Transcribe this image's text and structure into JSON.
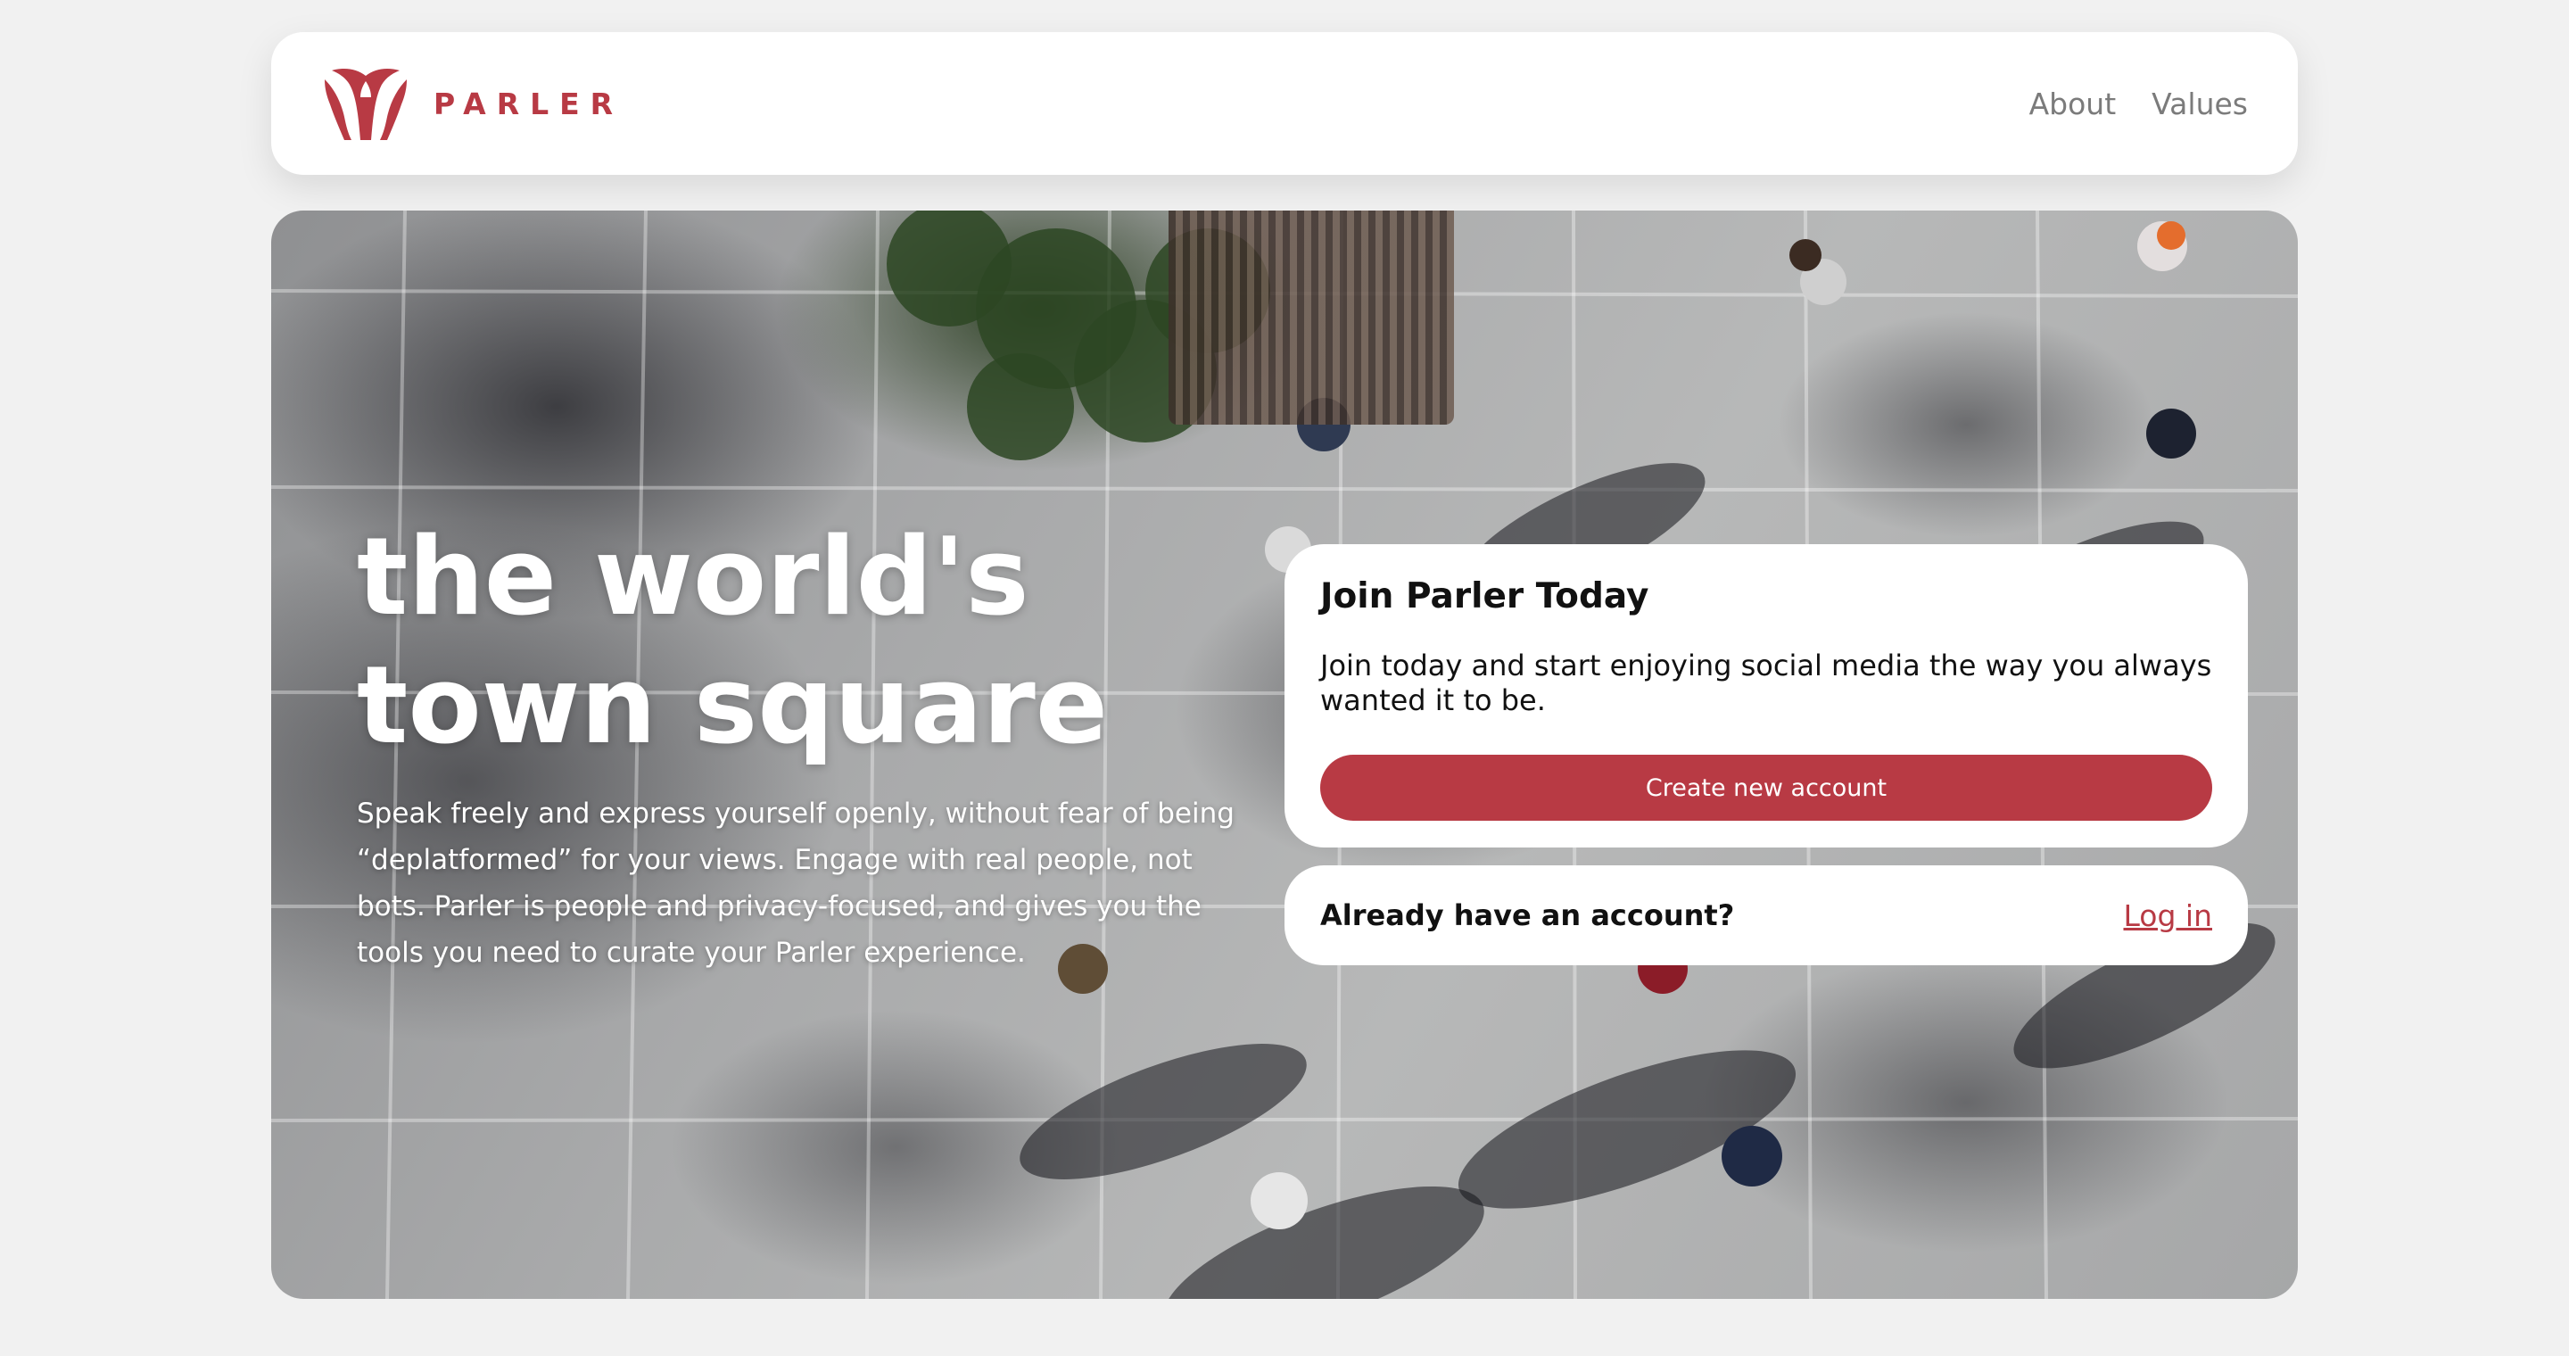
{
  "brand": {
    "name": "PARLER",
    "logo_icon": "parler-logo-icon",
    "color": "#b83a44"
  },
  "nav": {
    "items": [
      {
        "label": "About"
      },
      {
        "label": "Values"
      }
    ]
  },
  "hero": {
    "headline_line1": "the world's",
    "headline_line2": "town square",
    "body": "Speak freely and express yourself openly, without fear of being “deplatformed” for your views. Engage with real people, not bots. Parler is people and privacy-focused, and gives you the tools you need to curate your Parler experience."
  },
  "join_card": {
    "title": "Join Parler Today",
    "description": "Join today and start enjoying social media the way you always wanted it to be.",
    "button_label": "Create new account"
  },
  "login_card": {
    "prompt": "Already have an account?",
    "link_label": "Log in"
  },
  "colors": {
    "accent": "#b83a44",
    "page_background": "#f1f1f1",
    "card": "#ffffff"
  }
}
